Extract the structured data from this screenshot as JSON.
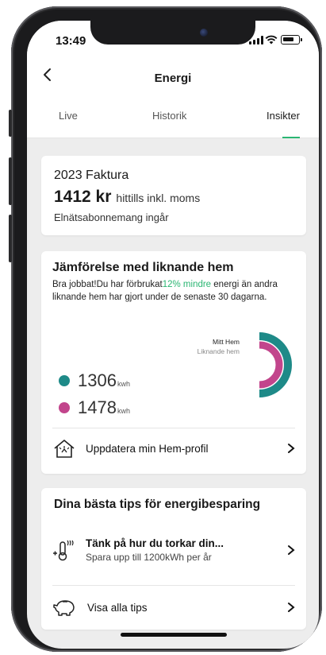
{
  "status_bar": {
    "time": "13:49"
  },
  "header": {
    "title": "Energi"
  },
  "tabs": [
    {
      "label": "Live"
    },
    {
      "label": "Historik"
    },
    {
      "label": "Insikter",
      "active": true
    }
  ],
  "invoice": {
    "heading": "2023 Faktura",
    "amount": "1412 kr",
    "amount_note": "hittills inkl. moms",
    "subscription_note": "Elnätsabonnemang ingår"
  },
  "comparison": {
    "heading": "Jämförelse med liknande hem",
    "description_prefix": "Bra jobbat!Du har förbrukat",
    "description_highlight": "12% mindre",
    "description_suffix": " energi än andra liknande hem har gjort under de senaste 30 dagarna.",
    "ring_label_my_home": "Mitt Hem",
    "ring_label_similar": "Liknande hem",
    "my_home_value": "1306",
    "similar_value": "1478",
    "unit": "kwh",
    "update_profile_label": "Uppdatera min Hem-profil"
  },
  "tips": {
    "heading": "Dina bästa tips för energibesparing",
    "tip_title": "Tänk på hur du torkar din...",
    "tip_subtitle": "Spara upp till 1200kWh per år",
    "show_all_label": "Visa alla tips"
  },
  "colors": {
    "accent_green": "#2bb673",
    "my_home_teal": "#1e8a88",
    "similar_magenta": "#c2458c"
  }
}
